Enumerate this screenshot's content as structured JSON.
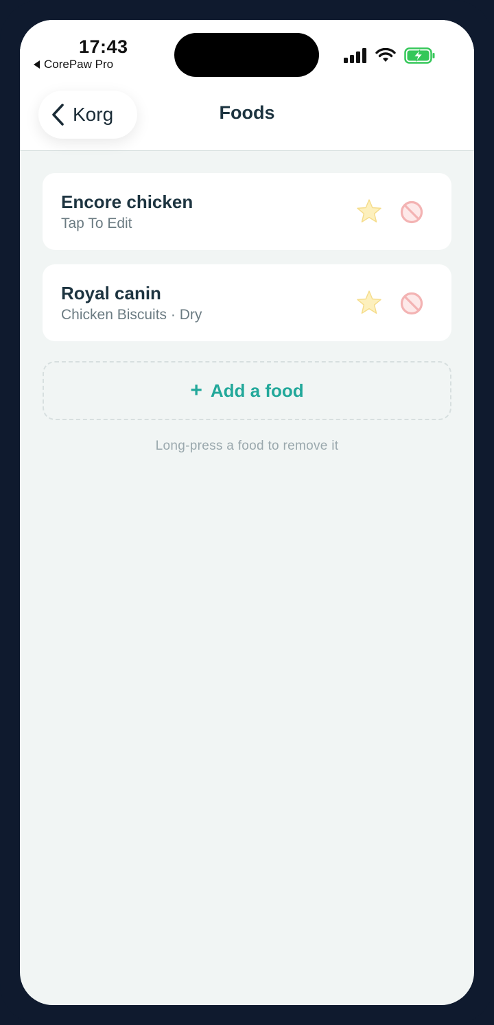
{
  "status_bar": {
    "time": "17:43",
    "back_app": "CorePaw Pro"
  },
  "nav": {
    "back_label": "Korg",
    "title": "Foods"
  },
  "foods": [
    {
      "name": "Encore chicken",
      "subtitle": "Tap To Edit"
    },
    {
      "name": "Royal canin",
      "subtitle": "Chicken Biscuits · Dry"
    }
  ],
  "add_food": {
    "plus": "+",
    "label": "Add a food"
  },
  "hint": "Long-press a food to remove it",
  "colors": {
    "accent": "#22a89a",
    "title_text": "#1d3440",
    "background": "#f1f5f4",
    "battery": "#35c759",
    "star": "#fbe9a8",
    "block": "#f5b5b5"
  }
}
